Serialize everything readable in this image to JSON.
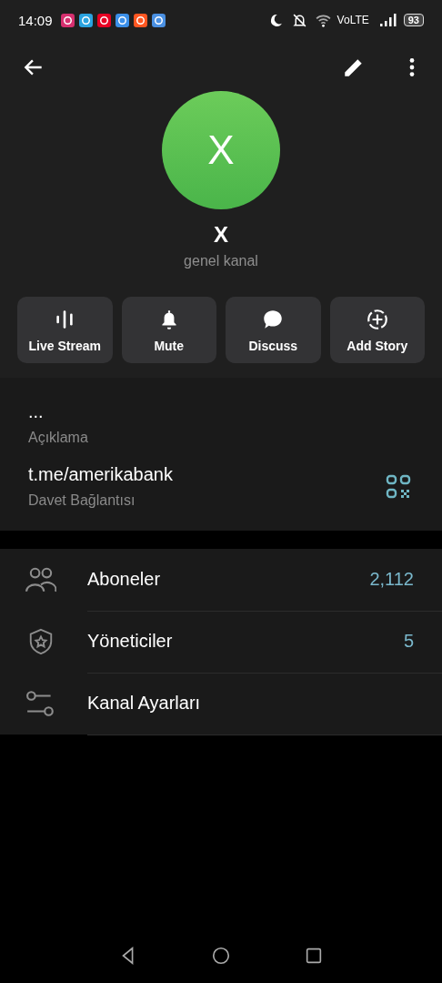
{
  "status_bar": {
    "time": "14:09",
    "network": "VoLTE",
    "battery": "93"
  },
  "profile": {
    "avatar_letter": "X",
    "name": "X",
    "subtitle": "genel kanal"
  },
  "actions": [
    {
      "kind": "stream",
      "label": "Live Stream"
    },
    {
      "kind": "mute",
      "label": "Mute"
    },
    {
      "kind": "discuss",
      "label": "Discuss"
    },
    {
      "kind": "story",
      "label": "Add Story"
    }
  ],
  "info": [
    {
      "value": "...",
      "caption": "Açıklama"
    },
    {
      "value": "t.me/amerikabank",
      "caption": "Davet Bağlantısı"
    }
  ],
  "menu": [
    {
      "kind": "subscribers",
      "label": "Aboneler",
      "count": "2,112"
    },
    {
      "kind": "admins",
      "label": "Yöneticiler",
      "count": "5"
    },
    {
      "kind": "settings",
      "label": "Kanal Ayarları"
    }
  ]
}
